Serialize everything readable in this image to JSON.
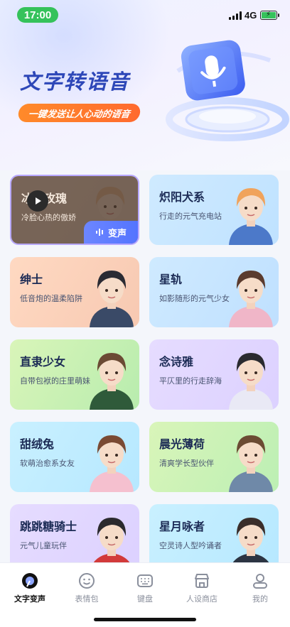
{
  "status": {
    "time": "17:00",
    "network": "4G"
  },
  "hero": {
    "title": "文字转语音",
    "subtitle": "一键发送让人心动的语音"
  },
  "voices": [
    {
      "name": "冰山玫瑰",
      "desc": "冷脸心热的傲娇",
      "selected": true,
      "tint": [
        "#f6d8c7",
        "#eed3bf"
      ]
    },
    {
      "name": "炽阳犬系",
      "desc": "行走的元气充电站",
      "tint": [
        "#cfeaff",
        "#bfe2ff"
      ]
    },
    {
      "name": "绅士",
      "desc": "低音炮的温柔陷阱",
      "tint": [
        "#ffd9c2",
        "#f7c9b2"
      ]
    },
    {
      "name": "星轨",
      "desc": "如影随形的元气少女",
      "tint": [
        "#cfeaff",
        "#bfe0ff"
      ]
    },
    {
      "name": "直隶少女",
      "desc": "自带包袱的庄里萌妹",
      "tint": [
        "#d9f5b9",
        "#b8ecae"
      ]
    },
    {
      "name": "念诗雅",
      "desc": "平仄里的行走辞海",
      "tint": [
        "#e6dcff",
        "#dcd1ff"
      ]
    },
    {
      "name": "甜绒兔",
      "desc": "软萌治愈系女友",
      "tint": [
        "#c9f0ff",
        "#b6e8ff"
      ]
    },
    {
      "name": "晨光薄荷",
      "desc": "清爽学长型伙伴",
      "tint": [
        "#d9f5b9",
        "#bcefb4"
      ]
    },
    {
      "name": "跳跳糖骑士",
      "desc": "元气儿童玩伴",
      "tint": [
        "#e6dcff",
        "#dcd1ff"
      ]
    },
    {
      "name": "星月咏者",
      "desc": "空灵诗人型吟诵者",
      "tint": [
        "#c9f0ff",
        "#b6e8ff"
      ]
    }
  ],
  "change_voice_label": "变声",
  "tabs": [
    {
      "label": "文字变声",
      "icon": "voice-icon",
      "active": true
    },
    {
      "label": "表情包",
      "icon": "emoji-icon"
    },
    {
      "label": "键盘",
      "icon": "keyboard-icon"
    },
    {
      "label": "人设商店",
      "icon": "store-icon"
    },
    {
      "label": "我的",
      "icon": "profile-icon"
    }
  ],
  "colors": {
    "accent": "#5474ff",
    "orange": "#ff7a2a",
    "title": "#2d47b8"
  }
}
